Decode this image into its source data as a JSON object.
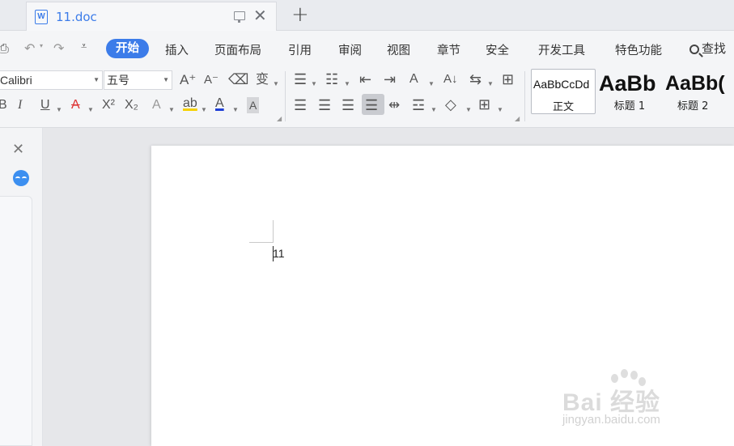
{
  "tab": {
    "title": "11.doc",
    "new_tab": "+"
  },
  "menu": {
    "items": [
      "开始",
      "插入",
      "页面布局",
      "引用",
      "审阅",
      "视图",
      "章节",
      "安全",
      "开发工具",
      "特色功能"
    ],
    "active": "开始",
    "search_label": "查找"
  },
  "ribbon": {
    "font_name": "Calibri",
    "font_size": "五号",
    "glyphs": {
      "grow": "A⁺",
      "shrink": "A⁻",
      "phonetic": "变",
      "bold": "B",
      "italic": "I",
      "underline": "U",
      "strike": "A",
      "superscript": "X²",
      "subscript": "X₂",
      "effect": "A",
      "highlight": "ab",
      "font_color": "A",
      "shade": "A",
      "sort": "A↓",
      "text_dir": "A"
    },
    "colors": {
      "highlight": "#f5d100",
      "font_color": "#1f3fd6"
    }
  },
  "styles": [
    {
      "preview": "AaBbCcDd",
      "name": "正文"
    },
    {
      "preview": "AaBb",
      "name": "标题 1"
    },
    {
      "preview": "AaBb(",
      "name": "标题 2"
    }
  ],
  "document": {
    "text": "11"
  },
  "watermark": {
    "main": "Bai 经验",
    "url": "jingyan.baidu.com"
  }
}
